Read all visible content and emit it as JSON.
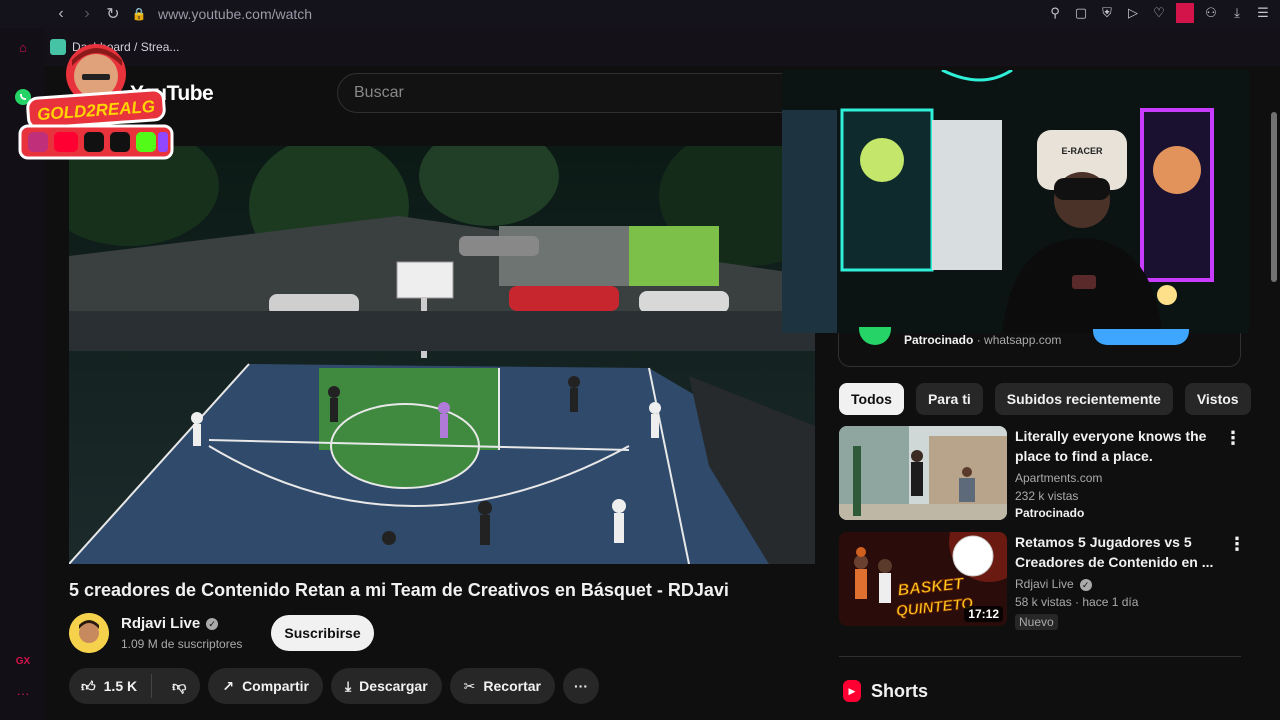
{
  "browser": {
    "url": "www.youtube.com/watch",
    "bookmark_label": "Dashboard / Strea..."
  },
  "overlay": {
    "brand": "GOLD2REALG"
  },
  "youtube": {
    "logo_text": "YouTube",
    "search_placeholder": "Buscar"
  },
  "video": {
    "title": "5 creadores de Contenido Retan a mi Team de Creativos en Básquet - RDJavi",
    "channel_name": "Rdjavi Live",
    "subscribers": "1.09 M de suscriptores",
    "subscribe_label": "Suscribirse",
    "likes": "1.5 K",
    "share_label": "Compartir",
    "download_label": "Descargar",
    "clip_label": "Recortar"
  },
  "sponsored": {
    "label": "Patrocinado",
    "domain": "· whatsapp.com"
  },
  "chips": [
    "Todos",
    "Para ti",
    "Subidos recientemente",
    "Vistos"
  ],
  "recommendations": [
    {
      "title": "Literally everyone knows the place to find a place.",
      "channel": "Apartments.com",
      "views": "232 k vistas",
      "badge": "Patrocinado"
    },
    {
      "title": "Retamos 5 Jugadores vs 5 Creadores de Contenido en ...",
      "channel": "Rdjavi Live",
      "views": "58 k vistas · hace 1 día",
      "badge": "Nuevo",
      "duration": "17:12",
      "thumb_text_1": "BASKET",
      "thumb_text_2": "QUINTETO"
    }
  ],
  "shorts_label": "Shorts",
  "colors": {
    "accent_red": "#ff0033",
    "whatsapp_green": "#25d366",
    "blue_button": "#3ea6ff",
    "opera_red": "#d2144a"
  }
}
